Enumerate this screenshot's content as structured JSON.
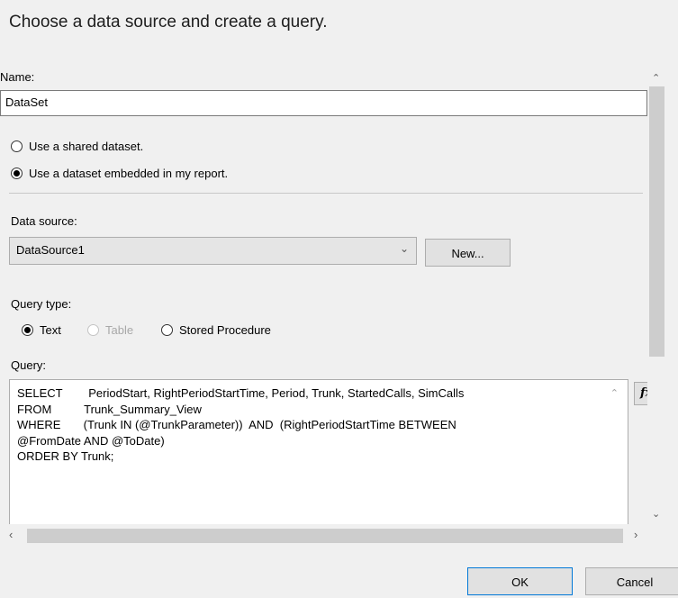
{
  "dialog": {
    "heading": "Choose a data source and create a query."
  },
  "name_field": {
    "label": "Name:",
    "value": "DataSet"
  },
  "dataset_options": [
    {
      "label": "Use a shared dataset.",
      "selected": false
    },
    {
      "label": "Use a dataset embedded in my report.",
      "selected": true
    }
  ],
  "data_source": {
    "label": "Data source:",
    "selected": "DataSource1",
    "new_button": "New..."
  },
  "query_type": {
    "label": "Query type:",
    "options": [
      {
        "label": "Text",
        "selected": true,
        "enabled": true
      },
      {
        "label": "Table",
        "selected": false,
        "enabled": false
      },
      {
        "label": "Stored Procedure",
        "selected": false,
        "enabled": true
      }
    ]
  },
  "query": {
    "label": "Query:",
    "text": "SELECT        PeriodStart, RightPeriodStartTime, Period, Trunk, StartedCalls, SimCalls\nFROM          Trunk_Summary_View\nWHERE       (Trunk IN (@TrunkParameter))  AND  (RightPeriodStartTime BETWEEN\n@FromDate AND @ToDate)\nORDER BY Trunk;",
    "expression_button": "fx"
  },
  "footer": {
    "ok_label": "OK",
    "cancel_label": "Cancel"
  }
}
